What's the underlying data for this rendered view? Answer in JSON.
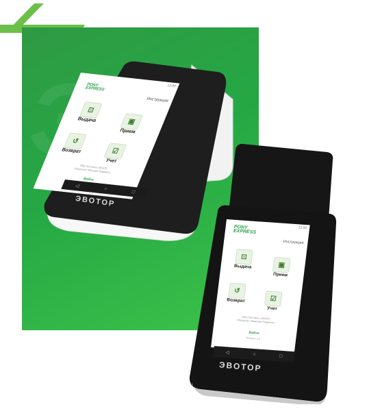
{
  "brand_name": "ЭВОТОР",
  "colors": {
    "accent": "#2aa24a",
    "panel": "#2fa84a",
    "stripe": "#6cc04a"
  },
  "app": {
    "logo_line1": "PONY",
    "logo_line2": "EXPRESS",
    "instructions": "Инструкции",
    "tiles": [
      {
        "label": "Выдача",
        "icon": "package-hand-icon"
      },
      {
        "label": "Прием",
        "icon": "scan-box-icon"
      },
      {
        "label": "Возврат",
        "icon": "return-box-icon"
      },
      {
        "label": "Учет",
        "icon": "checklist-icon"
      }
    ],
    "info_line1": "ПВЗ Лостаенъ №5870",
    "info_line2": "Оператор: Иванова Людмила",
    "login": "Войти",
    "version": "Версия 1.0",
    "time": "12:00"
  },
  "nav": {
    "back": "◁",
    "home": "○",
    "recent": "□"
  }
}
